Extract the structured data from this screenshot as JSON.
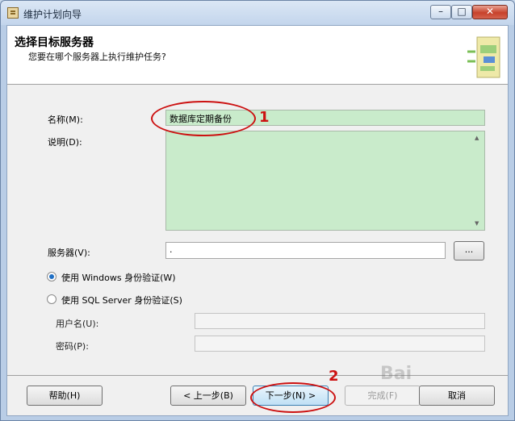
{
  "window": {
    "title": "维护计划向导",
    "icons": {
      "app": "wizard-app-icon",
      "minimize": "minimize-icon",
      "maximize": "maximize-icon",
      "close": "close-icon"
    },
    "caption_glyphs": {
      "minimize": "–",
      "maximize": "□",
      "close": "✕"
    }
  },
  "header": {
    "title": "选择目标服务器",
    "subtitle": "您要在哪个服务器上执行维护任务?",
    "graphic_icon": "wizard-graphic-icon"
  },
  "form": {
    "name": {
      "label": "名称(M):",
      "value": "数据库定期备份"
    },
    "description": {
      "label": "说明(D):",
      "value": ""
    },
    "server": {
      "label": "服务器(V):",
      "value": ".",
      "browse_label": "..."
    },
    "auth": {
      "windows": {
        "label": "使用 Windows 身份验证(W)",
        "selected": true
      },
      "sql": {
        "label": "使用 SQL Server 身份验证(S)",
        "selected": false
      }
    },
    "username": {
      "label": "用户名(U):",
      "value": ""
    },
    "password": {
      "label": "密码(P):",
      "value": ""
    }
  },
  "footer": {
    "help": "帮助(H)",
    "back": "< 上一步(B)",
    "next": "下一步(N) >",
    "finish": "完成(F)",
    "cancel": "取消"
  },
  "annotations": {
    "step1": "1",
    "step2": "2",
    "color": "#cc1111"
  },
  "scroll_glyphs": {
    "up": "▲",
    "down": "▼"
  },
  "watermark": "Bai"
}
